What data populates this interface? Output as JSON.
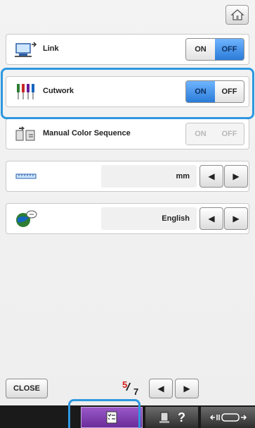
{
  "settings_rows": {
    "link": {
      "label": "Link",
      "on_label": "ON",
      "off_label": "OFF",
      "selected": "OFF"
    },
    "cutwork": {
      "label": "Cutwork",
      "on_label": "ON",
      "off_label": "OFF",
      "selected": "ON"
    },
    "manual_color_sequence": {
      "label": "Manual Color Sequence",
      "on_label": "ON",
      "off_label": "OFF",
      "disabled": true
    },
    "units": {
      "value": "mm",
      "prev_arrow": "◀",
      "next_arrow": "▶"
    },
    "language": {
      "value": "English",
      "prev_arrow": "◀",
      "next_arrow": "▶"
    }
  },
  "footer": {
    "close_label": "CLOSE",
    "page_current": "5",
    "page_total": "7",
    "prev_arrow": "◀",
    "next_arrow": "▶"
  },
  "bottom_tabs": {
    "help_glyph": "?"
  },
  "colors": {
    "selection_blue": "#2a7bd8",
    "highlight_outline": "#2e98e0",
    "active_tab_purple": "#7a38aa",
    "page_current_red": "#d41e1e"
  },
  "icons": {
    "home": "home-icon",
    "link": "computer-link-icon",
    "cutwork": "cutwork-needles-icon",
    "manual_color_sequence": "color-sequence-icon",
    "units": "ruler-icon",
    "language": "globe-speech-icon",
    "settings_tab": "settings-checklist-icon",
    "help_tab": "machine-help-icon",
    "hoop_tab": "hoop-move-icon"
  }
}
